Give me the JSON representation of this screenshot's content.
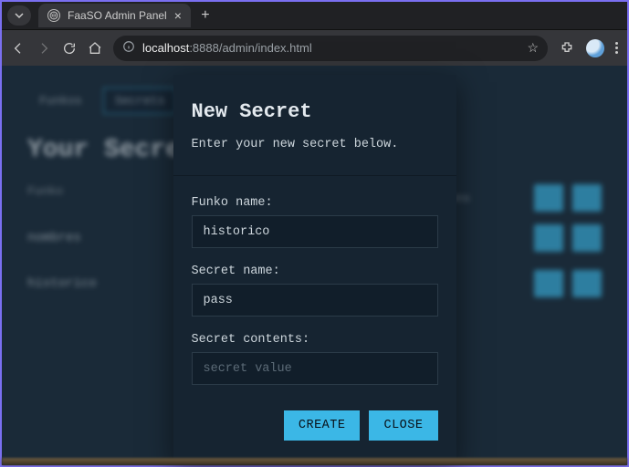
{
  "browser": {
    "tab_title": "FaaSO Admin Panel",
    "url_host": "localhost",
    "url_port_path": ":8888/admin/index.html"
  },
  "page": {
    "tabs": [
      "Funkos",
      "Secrets"
    ],
    "active_tab_index": 1,
    "title": "Your Secrets",
    "columns": {
      "left": "Funko",
      "right": "Actions"
    },
    "rows": [
      "nombres",
      "historico"
    ]
  },
  "modal": {
    "title": "New Secret",
    "subtitle": "Enter your new secret below.",
    "fields": {
      "funko_name": {
        "label": "Funko name:",
        "value": "historico",
        "placeholder": ""
      },
      "secret_name": {
        "label": "Secret name:",
        "value": "pass",
        "placeholder": ""
      },
      "secret_contents": {
        "label": "Secret contents:",
        "value": "",
        "placeholder": "secret value"
      }
    },
    "actions": {
      "create": "CREATE",
      "close": "CLOSE"
    }
  }
}
